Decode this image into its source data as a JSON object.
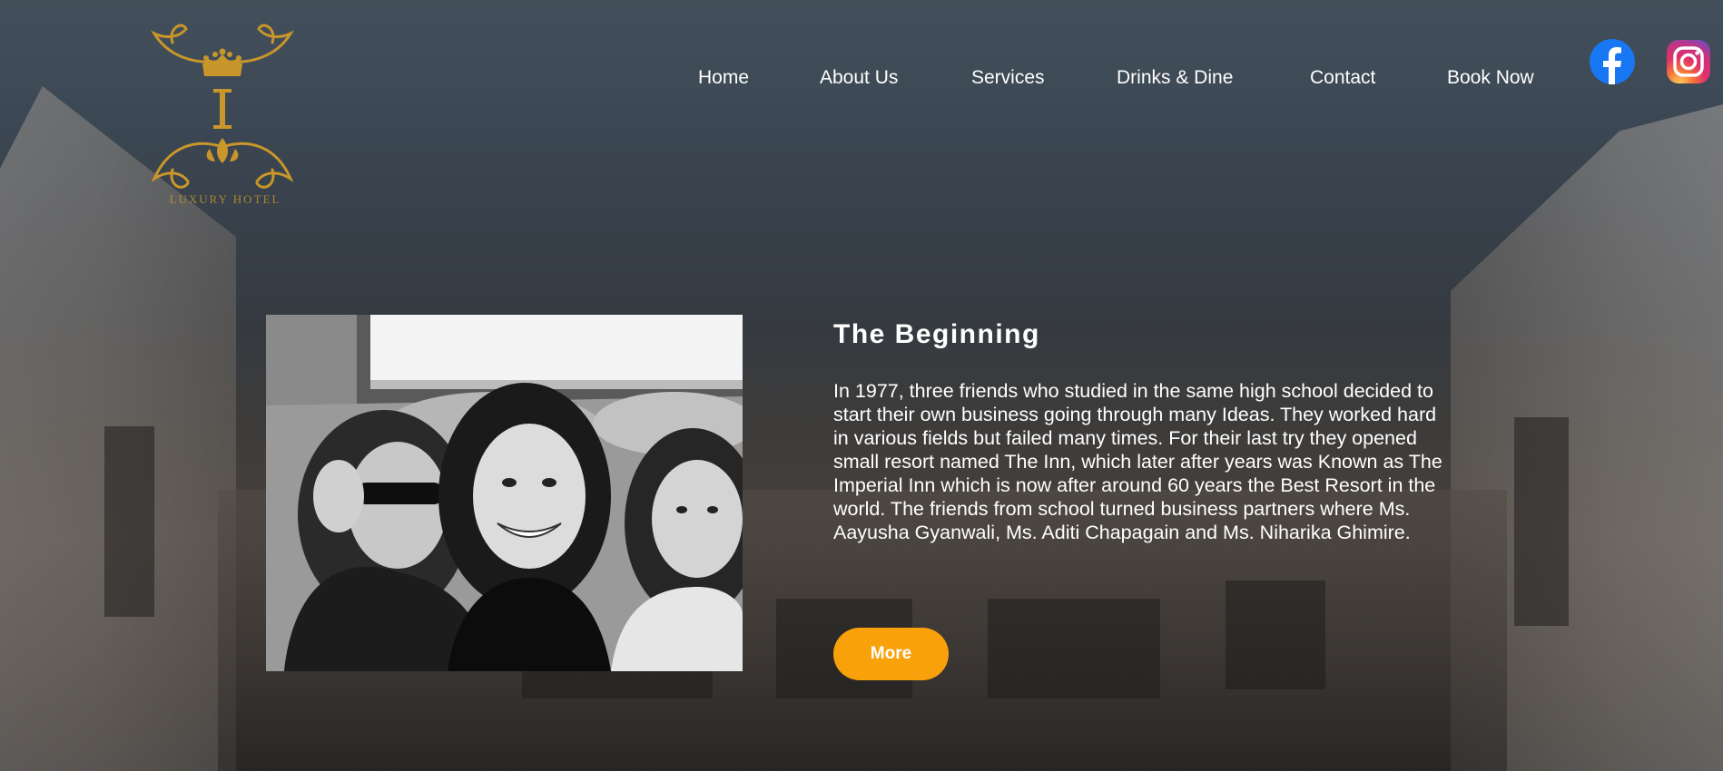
{
  "header": {
    "logo_tagline": "LUXURY HOTEL",
    "nav": [
      {
        "label": "Home"
      },
      {
        "label": "About Us"
      },
      {
        "label": "Services"
      },
      {
        "label": "Drinks & Dine"
      },
      {
        "label": "Contact"
      },
      {
        "label": "Book Now"
      }
    ],
    "social": [
      {
        "icon": "facebook-icon",
        "color": "#1877f2"
      },
      {
        "icon": "instagram-icon",
        "color": "#e1306c"
      }
    ]
  },
  "main": {
    "headline": "The Beginning",
    "body": "In 1977, three friends who studied in the same high school decided to start their own business going through many Ideas. They worked hard in various fields but failed many times. For their last try they opened small resort named The Inn, which later after years was Known as The Imperial Inn which is now after around 60 years the Best Resort in the world. The friends from school turned business partners where Ms. Aayusha Gyanwali, Ms. Aditi Chapagain and Ms. Niharika Ghimire.",
    "more_label": "More"
  },
  "colors": {
    "accent": "#f9a10b",
    "logo_gold": "#c8962a"
  }
}
